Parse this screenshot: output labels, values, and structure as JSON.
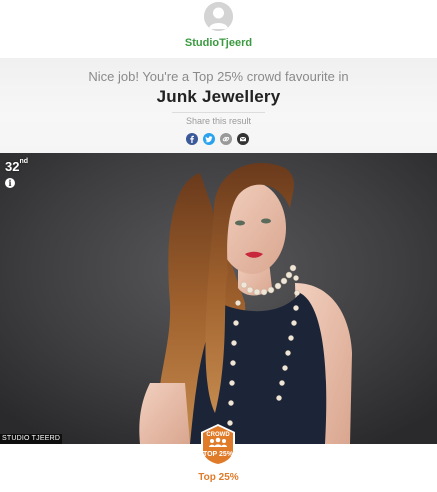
{
  "profile": {
    "username": "StudioTjeerd",
    "avatar_icon": "person-silhouette-icon"
  },
  "result": {
    "message": "Nice job! You're a Top 25% crowd favourite in",
    "category": "Junk Jewellery",
    "share_label": "Share this result",
    "share_buttons": [
      {
        "name": "facebook",
        "icon": "facebook-icon",
        "color": "#3b5998"
      },
      {
        "name": "twitter",
        "icon": "twitter-icon",
        "color": "#2aa3ef"
      },
      {
        "name": "link",
        "icon": "link-icon",
        "color": "#999999"
      },
      {
        "name": "email",
        "icon": "email-icon",
        "color": "#333333"
      }
    ]
  },
  "photo": {
    "rank_number": "32",
    "rank_suffix": "nd",
    "info_icon": "info-icon",
    "watermark": "STUDIO TJEERD"
  },
  "badge": {
    "top_text": "CROWD",
    "bottom_text": "TOP 25%",
    "icon": "crowd-icon",
    "color": "#e07b2a",
    "label": "Top 25%"
  }
}
